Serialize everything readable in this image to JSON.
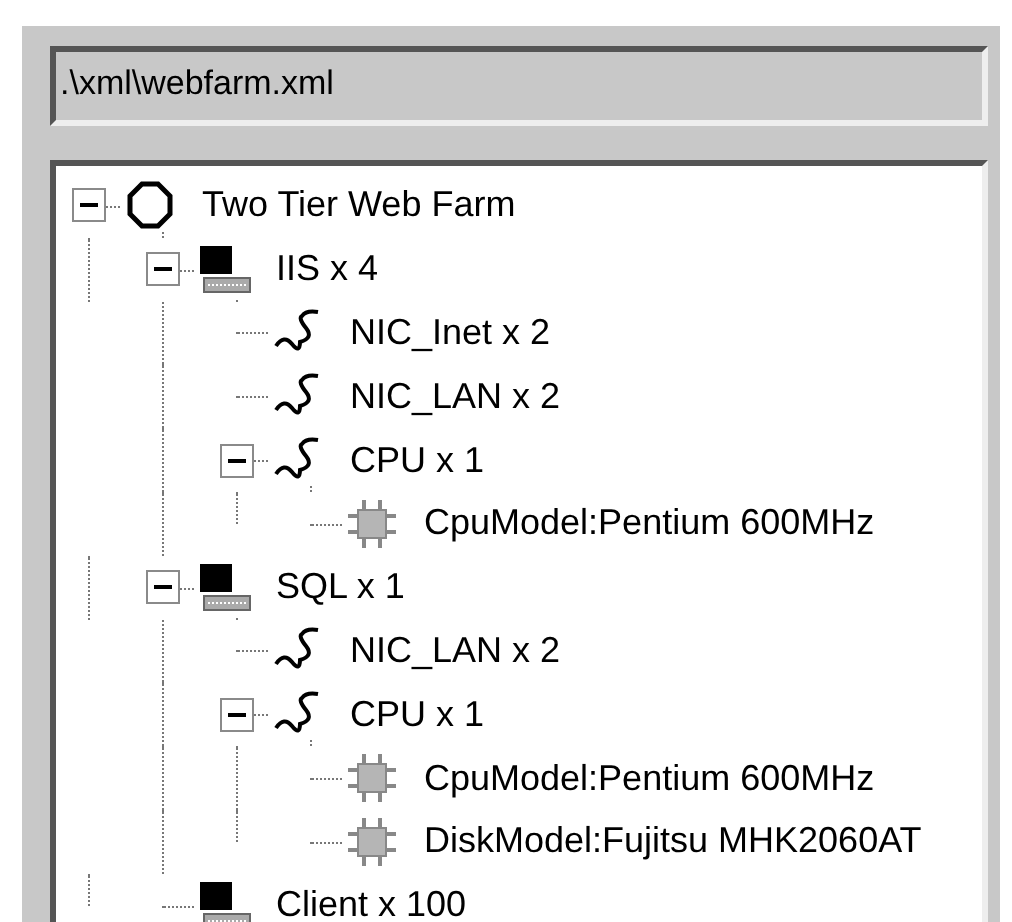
{
  "path_field": {
    "value": ".\\xml\\webfarm.xml"
  },
  "tree": [
    {
      "kind": "farm",
      "label": "Two Tier Web Farm",
      "expanded": true,
      "children": [
        {
          "kind": "computer",
          "label": "IIS x 4",
          "expanded": true,
          "children": [
            {
              "kind": "component",
              "label": "NIC_Inet x 2"
            },
            {
              "kind": "component",
              "label": "NIC_LAN x 2"
            },
            {
              "kind": "component",
              "label": "CPU x 1",
              "expanded": true,
              "children": [
                {
                  "kind": "property",
                  "label": "CpuModel:Pentium 600MHz"
                }
              ]
            }
          ]
        },
        {
          "kind": "computer",
          "label": "SQL x 1",
          "expanded": true,
          "children": [
            {
              "kind": "component",
              "label": "NIC_LAN x 2"
            },
            {
              "kind": "component",
              "label": "CPU x 1",
              "expanded": true,
              "children": [
                {
                  "kind": "property",
                  "label": "CpuModel:Pentium 600MHz"
                },
                {
                  "kind": "property",
                  "label": "DiskModel:Fujitsu MHK2060AT"
                }
              ]
            }
          ]
        },
        {
          "kind": "computer",
          "label": "Client x 100"
        }
      ]
    }
  ]
}
